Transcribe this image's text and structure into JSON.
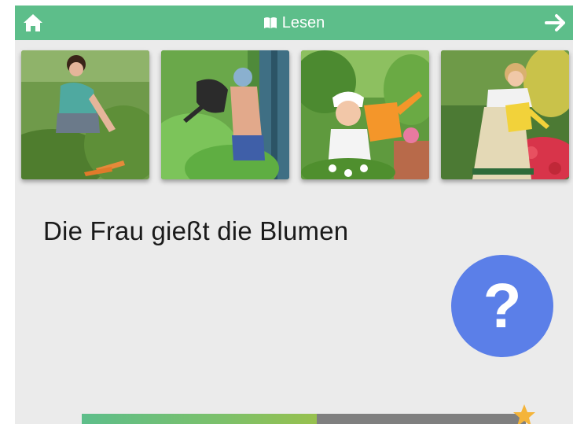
{
  "app": {
    "title": "Lesen",
    "accent_color": "#5dbe8a",
    "background_color": "#ebebeb"
  },
  "header": {
    "home_icon": "home-icon",
    "title_icon": "book-icon",
    "next_icon": "arrow-right-icon"
  },
  "images": [
    {
      "name": "woman-harvesting-carrots"
    },
    {
      "name": "boy-watering-with-can"
    },
    {
      "name": "girl-with-orange-watering-can"
    },
    {
      "name": "woman-watering-flowers"
    }
  ],
  "sentence": "Die Frau gießt die Blumen",
  "help_button": {
    "label": "?",
    "color": "#5b7fe8"
  },
  "progress": {
    "fraction": 0.53,
    "star_icon": "star-icon",
    "star_color": "#f4b43a"
  }
}
